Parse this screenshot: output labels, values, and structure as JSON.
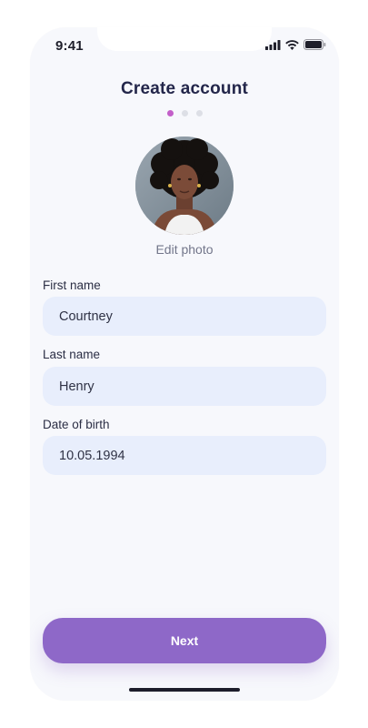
{
  "status_bar": {
    "time": "9:41",
    "icons": [
      "signal-icon",
      "wifi-icon",
      "battery-icon"
    ]
  },
  "header": {
    "title": "Create account",
    "steps": {
      "total": 3,
      "current": 1
    }
  },
  "profile": {
    "edit_photo_label": "Edit photo"
  },
  "form": {
    "first_name": {
      "label": "First name",
      "value": "Courtney"
    },
    "last_name": {
      "label": "Last name",
      "value": "Henry"
    },
    "dob": {
      "label": "Date of birth",
      "value": "10.05.1994"
    }
  },
  "actions": {
    "next_label": "Next"
  },
  "colors": {
    "accent": "#8e68c8",
    "active_step": "#c35fc9",
    "field_bg": "#e8eefc",
    "title": "#23264a"
  }
}
